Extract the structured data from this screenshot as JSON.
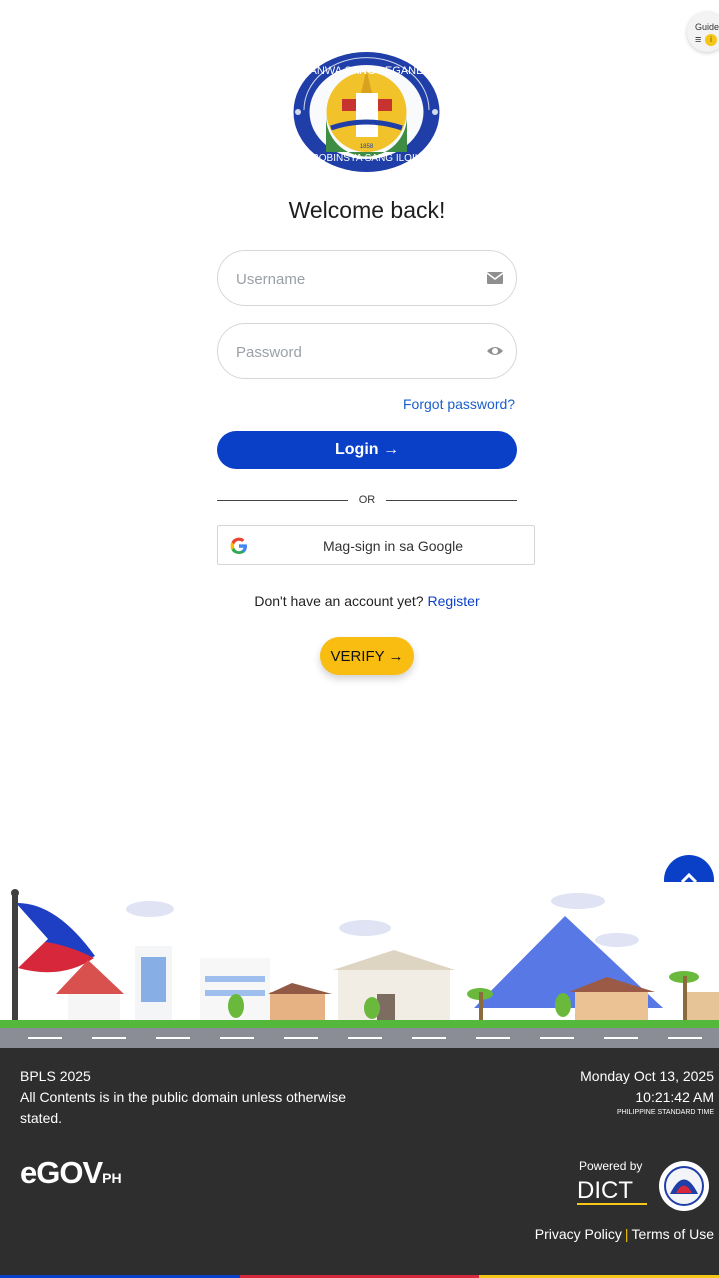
{
  "guide": {
    "label": "Guide",
    "menu_glyph": "≡",
    "badge": "i"
  },
  "seal": {
    "top_text": "BANWA SANG LEGANES",
    "bottom_text": "PROBINSYA SANG ILOILO",
    "year": "1858"
  },
  "welcome": "Welcome back!",
  "form": {
    "username_placeholder": "Username",
    "password_placeholder": "Password",
    "forgot": "Forgot password?",
    "login": "Login",
    "login_arrow": "→",
    "or": "OR",
    "google": "Mag-sign in sa Google",
    "signup_prompt": "Don't have an account yet?",
    "register": "Register",
    "verify": "VERIFY",
    "verify_arrow": "→"
  },
  "footer": {
    "app": "BPLS 2025",
    "notice": "All Contents is in the public domain unless otherwise stated.",
    "date": "Monday Oct 13, 2025",
    "time": "10:21:42 AM",
    "timezone": "PHILIPPINE STANDARD TIME",
    "egov_main": "eGOV",
    "egov_suffix": "PH",
    "powered": "Powered by",
    "dict": "DICT",
    "privacy": "Privacy Policy",
    "separator": "|",
    "terms": "Terms of Use"
  },
  "colors": {
    "primary": "#0a3fc8",
    "verify": "#f8bd10",
    "footer": "#2e2e2e"
  },
  "icons": {
    "username": "envelope-icon",
    "password": "eye-icon",
    "google": "google-logo-icon",
    "top": "chevron-up-icon"
  }
}
